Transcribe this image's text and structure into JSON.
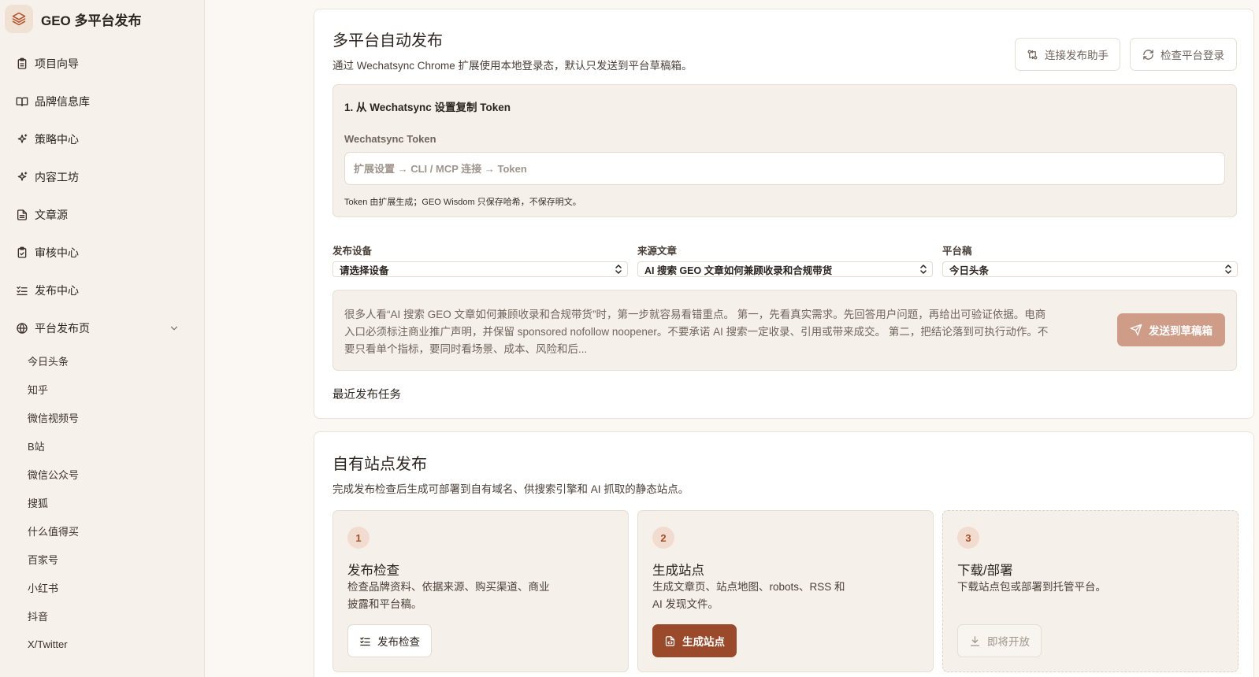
{
  "app": {
    "title": "GEO 多平台发布"
  },
  "sidebar": {
    "items": [
      {
        "label": "项目向导",
        "icon": "clipboard-icon"
      },
      {
        "label": "品牌信息库",
        "icon": "book-open-icon"
      },
      {
        "label": "策略中心",
        "icon": "sparkles-icon"
      },
      {
        "label": "内容工坊",
        "icon": "sparkles-icon"
      },
      {
        "label": "文章源",
        "icon": "file-text-icon"
      },
      {
        "label": "审核中心",
        "icon": "clipboard-check-icon"
      },
      {
        "label": "发布中心",
        "icon": "list-check-icon"
      },
      {
        "label": "平台发布页",
        "icon": "globe-icon"
      }
    ],
    "platforms": [
      "今日头条",
      "知乎",
      "微信视频号",
      "B站",
      "微信公众号",
      "搜狐",
      "什么值得买",
      "百家号",
      "小红书",
      "抖音",
      "X/Twitter"
    ]
  },
  "publish": {
    "title": "多平台自动发布",
    "desc": "通过 Wechatsync Chrome 扩展使用本地登录态，默认只发送到平台草稿箱。",
    "connect_label": "连接发布助手",
    "check_label": "检查平台登录",
    "token_step": "1. 从 Wechatsync 设置复制 Token",
    "token_label": "Wechatsync Token",
    "token_placeholder": "扩展设置 → CLI / MCP 连接 → Token",
    "token_value": "",
    "token_note": "Token 由扩展生成；GEO Wisdom 只保存哈希，不保存明文。",
    "device_label": "发布设备",
    "device_value": "请选择设备",
    "article_label": "来源文章",
    "article_value": "AI 搜索 GEO 文章如何兼顾收录和合规带货",
    "platform_label": "平台稿",
    "platform_value": "今日头条",
    "preview_text": "很多人看“AI 搜索 GEO 文章如何兼顾收录和合规带货”时，第一步就容易看错重点。 第一，先看真实需求。先回答用户问题，再给出可验证依据。电商入口必须标注商业推广声明，并保留 sponsored nofollow noopener。不要承诺 AI 搜索一定收录、引用或带来成交。 第二，把结论落到可执行动作。不要只看单个指标，要同时看场景、成本、风险和后...",
    "send_draft_label": "发送到草稿箱",
    "recent_title": "最近发布任务"
  },
  "site": {
    "title": "自有站点发布",
    "desc": "完成发布检查后生成可部署到自有域名、供搜索引擎和 AI 抓取的静态站点。",
    "steps": [
      {
        "num": "1",
        "title": "发布检查",
        "desc": "检查品牌资料、依据来源、购买渠道、商业披露和平台稿。",
        "button": "发布检查"
      },
      {
        "num": "2",
        "title": "生成站点",
        "desc": "生成文章页、站点地图、robots、RSS 和 AI 发现文件。",
        "button": "生成站点"
      },
      {
        "num": "3",
        "title": "下载/部署",
        "desc": "下载站点包或部署到托管平台。",
        "button": "即将开放"
      }
    ]
  },
  "colors": {
    "accent": "#9a4a2b",
    "accent_light": "#cf9c87",
    "sidebar_bg": "#f6f1ea",
    "panel_bg": "#f5f0ea"
  }
}
